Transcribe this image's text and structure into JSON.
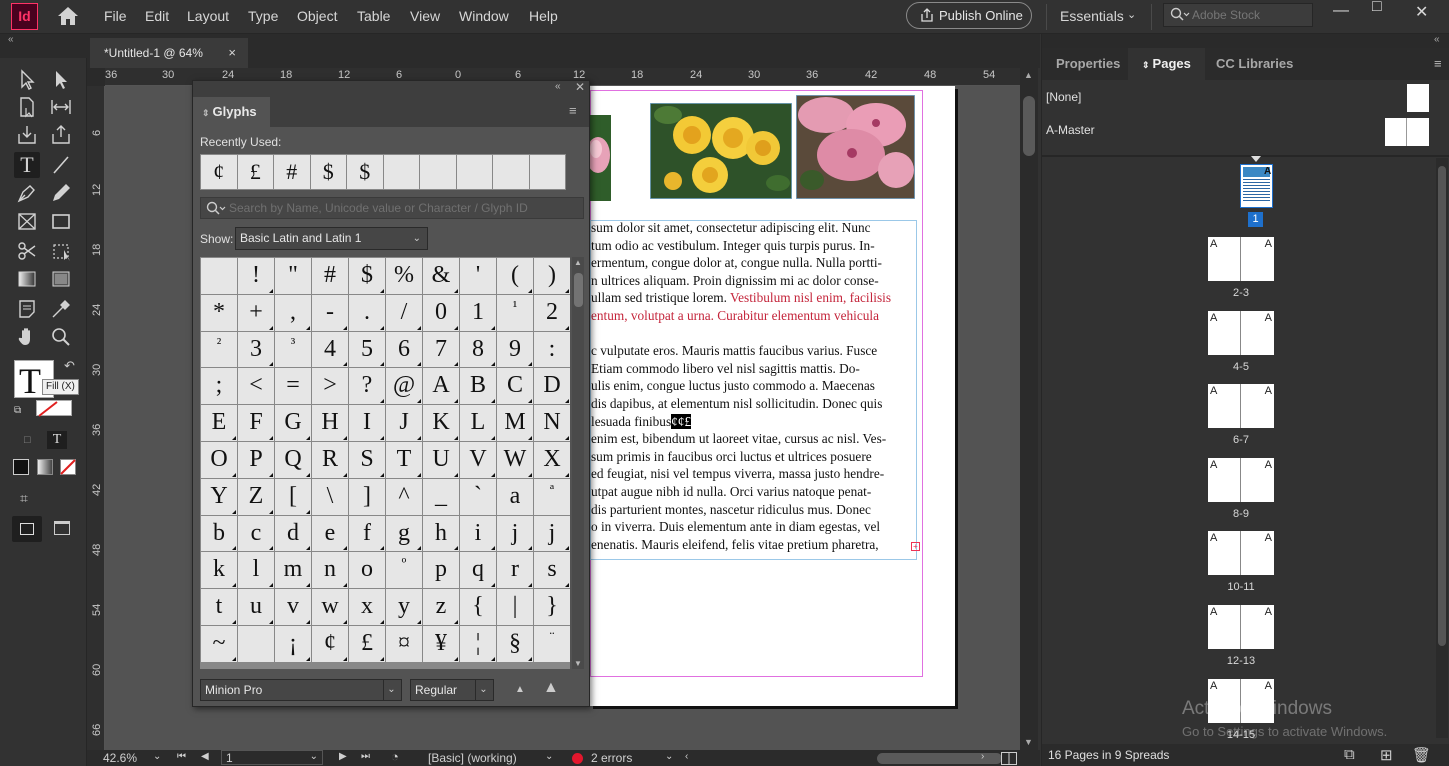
{
  "app": {
    "logo": "Id",
    "brand_color": "#ff3366"
  },
  "menu": [
    "File",
    "Edit",
    "Layout",
    "Type",
    "Object",
    "Table",
    "View",
    "Window",
    "Help"
  ],
  "publish": {
    "label": "Publish Online"
  },
  "workspace": {
    "label": "Essentials"
  },
  "stock_search": {
    "placeholder": "Adobe Stock"
  },
  "window_controls": [
    "—",
    "□",
    "✕"
  ],
  "document_tab": {
    "title": "*Untitled-1 @ 64%",
    "close": "×"
  },
  "ruler_top": [
    "36",
    "30",
    "24",
    "18",
    "12",
    "6",
    "0",
    "6",
    "12",
    "18",
    "24",
    "30",
    "36",
    "42",
    "48",
    "54"
  ],
  "ruler_left": [
    "6",
    "12",
    "18",
    "24",
    "30",
    "36",
    "42",
    "48",
    "54",
    "60",
    "66"
  ],
  "tooltip": {
    "fill": "Fill (X)"
  },
  "document": {
    "lines": [
      {
        "text": "sum dolor sit amet, consectetur adipiscing elit. Nunc"
      },
      {
        "text": "tum odio ac vestibulum. Integer quis turpis purus. In-"
      },
      {
        "text": "ermentum, congue dolor at, congue nulla. Nulla portti-"
      },
      {
        "text": "n ultrices aliquam. Proin dignissim mi ac dolor conse-"
      },
      {
        "text": "ullam sed tristique lorem. ",
        "red": "Vestibulum nisl enim, facilisis"
      },
      {
        "text": "",
        "red": "entum, volutpat a urna. Curabitur elementum vehicula"
      },
      {
        "text": ""
      },
      {
        "text": "c vulputate eros. Mauris mattis faucibus varius. Fusce"
      },
      {
        "text": "Etiam commodo libero vel nisl sagittis mattis. Do-"
      },
      {
        "text": "ulis enim, congue luctus justo commodo a. Maecenas"
      },
      {
        "text": "dis dapibus, at elementum nisl sollicitudin. Donec quis"
      },
      {
        "text": "lesuada finibus",
        "highlight": "¢¢£"
      },
      {
        "text": "enim est, bibendum ut laoreet vitae, cursus ac nisl. Ves-"
      },
      {
        "text": "sum primis in faucibus orci luctus et ultrices posuere"
      },
      {
        "text": "ed feugiat, nisi vel tempus viverra, massa justo hendre-"
      },
      {
        "text": "utpat augue nibh id nulla. Orci varius natoque penat-"
      },
      {
        "text": "dis parturient montes, nascetur ridiculus mus. Donec"
      },
      {
        "text": "o in viverra. Duis elementum ante in diam egestas, vel"
      },
      {
        "text": "enenatis. Mauris eleifend, felis vitae pretium pharetra,"
      }
    ],
    "overset_marker": "+"
  },
  "status_bar": {
    "zoom": "42.6%",
    "page": "1",
    "preflight_profile": "[Basic] (working)",
    "errors": "2 errors"
  },
  "glyphs": {
    "title": "Glyphs",
    "recently_used_label": "Recently Used:",
    "recently_used": [
      "¢",
      "£",
      "#",
      "$",
      "$",
      "",
      "",
      "",
      "",
      ""
    ],
    "search_placeholder": "Search by Name, Unicode value or Character / Glyph ID",
    "show_label": "Show:",
    "show_value": "Basic Latin and Latin 1",
    "grid": [
      " ",
      "!",
      "\"",
      "#",
      "$",
      "%",
      "&",
      "'",
      "(",
      ")",
      "*",
      "+",
      ",",
      "-",
      ".",
      "/",
      "0",
      "1",
      "¹",
      "2",
      "²",
      "3",
      "³",
      "4",
      "5",
      "6",
      "7",
      "8",
      "9",
      ":",
      ";",
      "<",
      "=",
      ">",
      "?",
      "@",
      "A",
      "B",
      "C",
      "D",
      "E",
      "F",
      "G",
      "H",
      "I",
      "J",
      "K",
      "L",
      "M",
      "N",
      "O",
      "P",
      "Q",
      "R",
      "S",
      "T",
      "U",
      "V",
      "W",
      "X",
      "Y",
      "Z",
      "[",
      "\\",
      "]",
      "^",
      "_",
      "`",
      "a",
      "ª",
      "b",
      "c",
      "d",
      "e",
      "f",
      "g",
      "h",
      "i",
      "j",
      "j",
      "k",
      "l",
      "m",
      "n",
      "o",
      "º",
      "p",
      "q",
      "r",
      "s",
      "t",
      "u",
      "v",
      "w",
      "x",
      "y",
      "z",
      "{",
      "|",
      "}",
      "~",
      "",
      "¡",
      "¢",
      "£",
      "¤",
      "¥",
      "¦",
      "§",
      "¨"
    ],
    "font": "Minion Pro",
    "style": "Regular"
  },
  "right_panel": {
    "tabs": [
      "Properties",
      "Pages",
      "CC Libraries"
    ],
    "active_tab": "Pages",
    "masters": [
      {
        "name": "[None]"
      },
      {
        "name": "A-Master"
      }
    ],
    "page1": {
      "number": "1",
      "master": "A"
    },
    "spreads": [
      "2-3",
      "4-5",
      "6-7",
      "8-9",
      "10-11",
      "12-13",
      "14-15"
    ],
    "spread_master": "A",
    "pages_summary": "16 Pages in 9 Spreads"
  },
  "watermark": {
    "line1": "Activate Windows",
    "line2": "Go to Settings to activate Windows."
  }
}
